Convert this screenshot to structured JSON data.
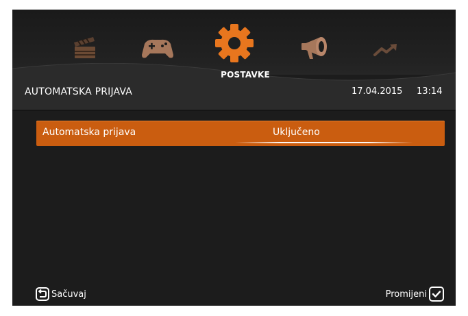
{
  "menu": {
    "items": [
      {
        "id": "clapperboard-icon",
        "label": ""
      },
      {
        "id": "gamepad-icon",
        "label": ""
      },
      {
        "id": "gear-icon",
        "label": "POSTAVKE"
      },
      {
        "id": "megaphone-icon",
        "label": ""
      },
      {
        "id": "trend-icon",
        "label": ""
      }
    ],
    "active_label": "POSTAVKE",
    "accent_color": "#e8761e"
  },
  "header": {
    "title": "AUTOMATSKA PRIJAVA",
    "date": "17.04.2015",
    "time": "13:14"
  },
  "settings": {
    "rows": [
      {
        "label": "Automatska prijava",
        "value": "Uključeno",
        "highlight_color": "#ca5d10"
      }
    ]
  },
  "footer": {
    "save_label": "Sačuvaj",
    "change_label": "Promijeni"
  }
}
